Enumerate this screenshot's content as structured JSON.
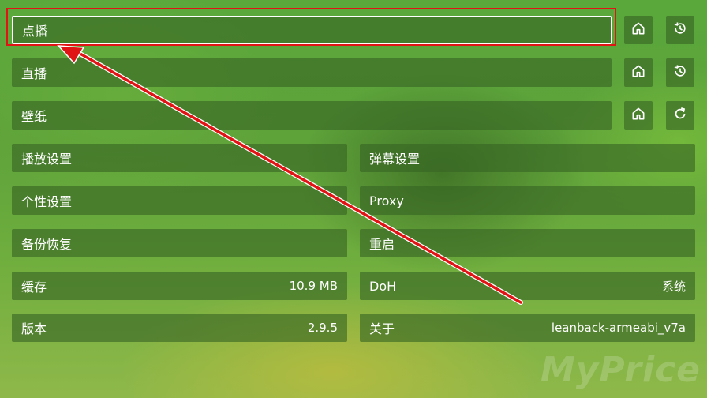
{
  "rows": {
    "vod": {
      "label": "点播"
    },
    "live": {
      "label": "直播"
    },
    "wallpaper": {
      "label": "壁纸"
    },
    "player_settings": {
      "label": "播放设置"
    },
    "danmaku_settings": {
      "label": "弹幕设置"
    },
    "personal_settings": {
      "label": "个性设置"
    },
    "proxy": {
      "label": "Proxy"
    },
    "backup": {
      "label": "备份恢复"
    },
    "restart": {
      "label": "重启"
    },
    "cache": {
      "label": "缓存",
      "value": "10.9 MB"
    },
    "doh": {
      "label": "DoH",
      "value": "系统"
    },
    "version": {
      "label": "版本",
      "value": "2.9.5"
    },
    "about": {
      "label": "关于",
      "value": "leanback-armeabi_v7a"
    }
  },
  "icons": {
    "vod_home": "home-icon",
    "vod_history": "history-icon",
    "live_home": "home-icon",
    "live_history": "history-icon",
    "wallpaper_home": "home-icon",
    "wallpaper_refresh": "refresh-icon"
  },
  "watermark": "MyPrice",
  "colors": {
    "annotation_red": "#e01414",
    "focus_border": "#ffffff"
  }
}
